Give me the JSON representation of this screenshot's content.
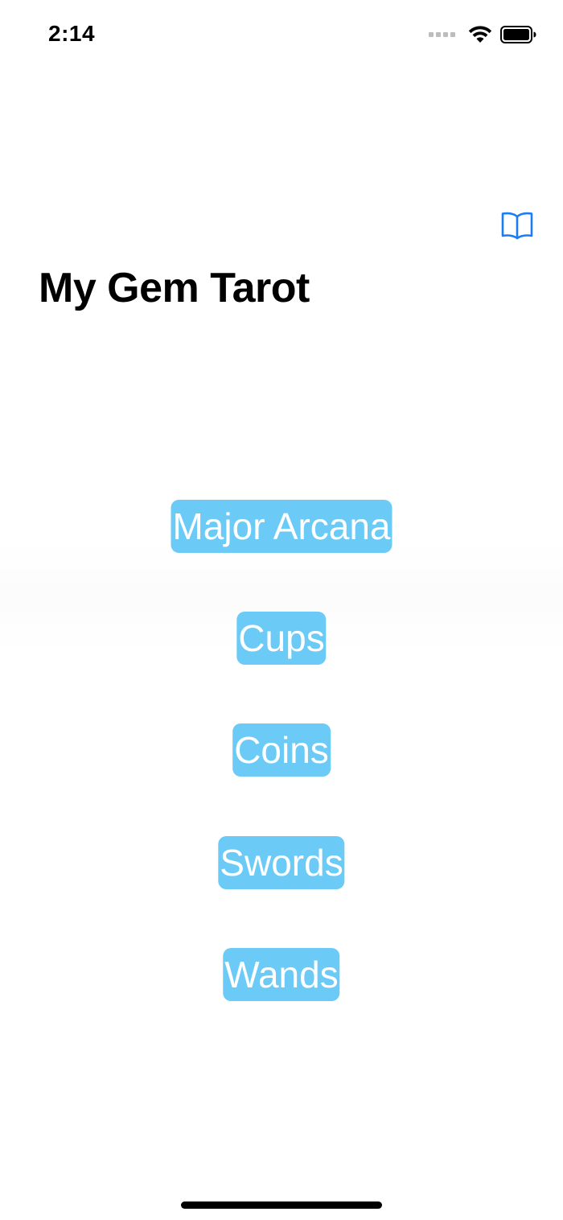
{
  "status_bar": {
    "time": "2:14",
    "signal_icon": "signal-dots-icon",
    "wifi_icon": "wifi-icon",
    "battery_icon": "battery-icon"
  },
  "nav": {
    "book_icon": "book-icon",
    "accent_color": "#1a7ef2"
  },
  "page": {
    "title": "My Gem Tarot"
  },
  "menu": {
    "button_color": "#6ccbf6",
    "items": [
      {
        "label": "Major Arcana"
      },
      {
        "label": "Cups"
      },
      {
        "label": "Coins"
      },
      {
        "label": "Swords"
      },
      {
        "label": "Wands"
      }
    ]
  }
}
